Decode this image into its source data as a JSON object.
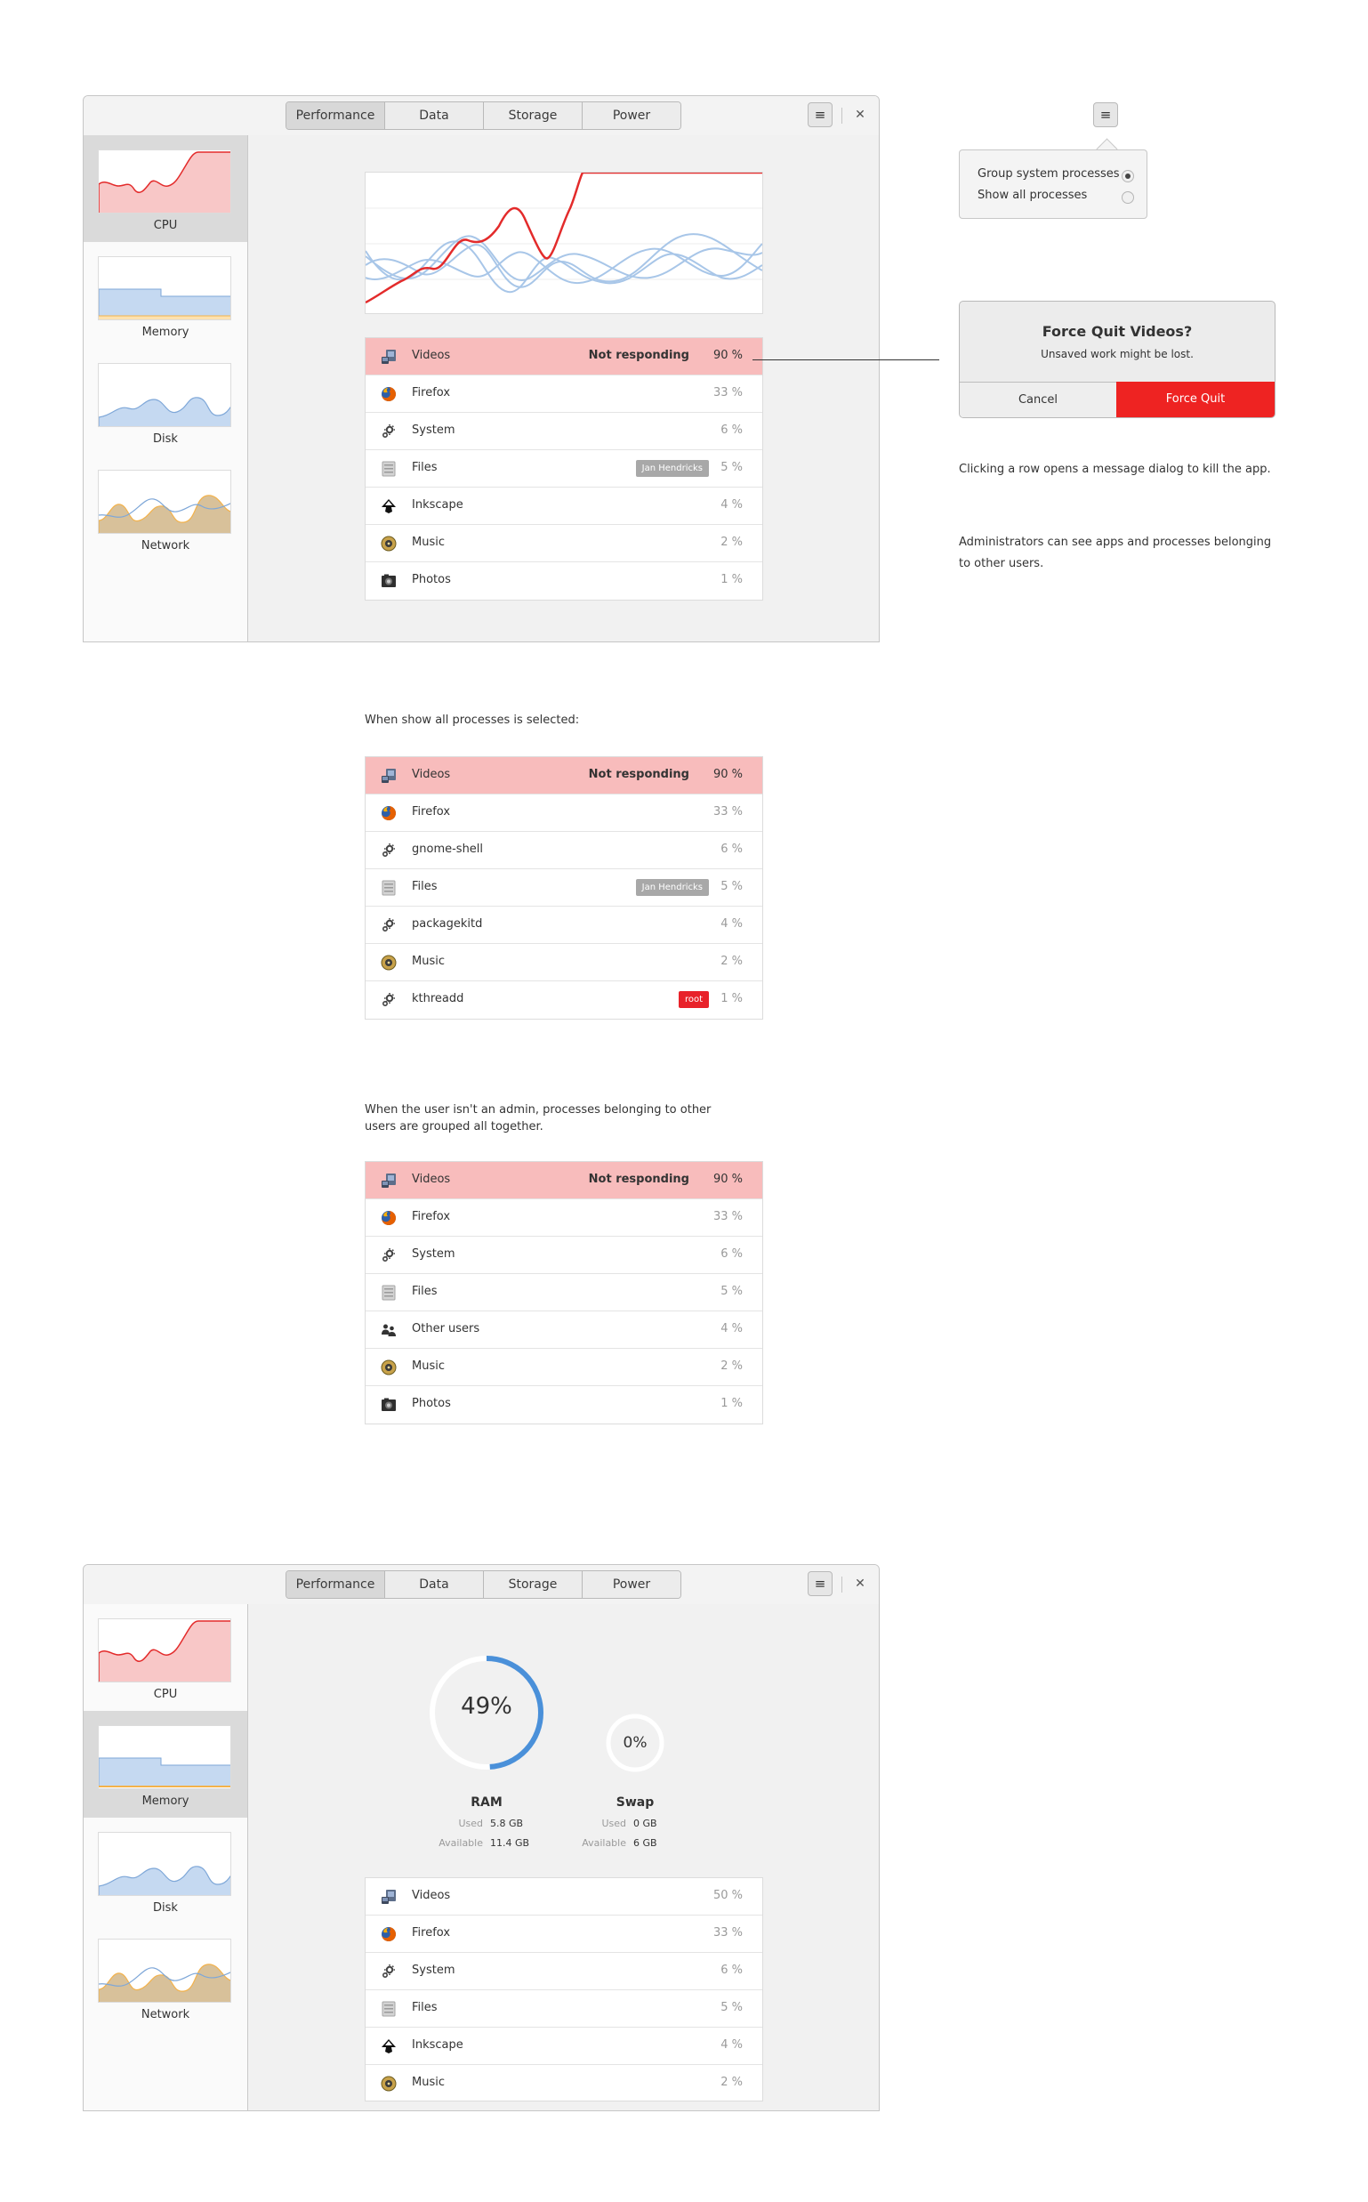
{
  "window": {
    "tabs": [
      "Performance",
      "Data",
      "Storage",
      "Power"
    ],
    "menu_icon": "hamburger-icon",
    "close_icon": "close-icon",
    "sidebar": [
      "CPU",
      "Memory",
      "Disk",
      "Network"
    ]
  },
  "list1": [
    {
      "name": "Videos",
      "status": "Not responding",
      "value": "90 %",
      "icon": "videos-icon"
    },
    {
      "name": "Firefox",
      "value": "33 %",
      "icon": "firefox-icon"
    },
    {
      "name": "System",
      "value": "6 %",
      "icon": "gear-icon"
    },
    {
      "name": "Files",
      "badge": "Jan Hendricks",
      "value": "5 %",
      "icon": "files-icon"
    },
    {
      "name": "Inkscape",
      "value": "4 %",
      "icon": "inkscape-icon"
    },
    {
      "name": "Music",
      "value": "2 %",
      "icon": "music-icon"
    },
    {
      "name": "Photos",
      "value": "1 %",
      "icon": "photos-icon"
    }
  ],
  "popover": {
    "options": [
      "Group system processes",
      "Show all processes"
    ],
    "selected": 0
  },
  "dialog": {
    "title": "Force Quit Videos?",
    "subtitle": "Unsaved work might be lost.",
    "cancel": "Cancel",
    "confirm": "Force Quit"
  },
  "notes": {
    "dialog_note": "Clicking a row opens a message dialog to kill the app.",
    "admin_note_1": "Administrators can see apps and processes belonging",
    "admin_note_2": "to other users.",
    "all_processes_note": "When show all processes is selected:",
    "non_admin_note_1": "When the user isn't an admin, processes belonging to other",
    "non_admin_note_2": "users are grouped all together."
  },
  "list2": [
    {
      "name": "Videos",
      "status": "Not responding",
      "value": "90 %",
      "icon": "videos-icon"
    },
    {
      "name": "Firefox",
      "value": "33 %",
      "icon": "firefox-icon"
    },
    {
      "name": "gnome-shell",
      "value": "6 %",
      "icon": "gear-icon"
    },
    {
      "name": "Files",
      "badge": "Jan Hendricks",
      "value": "5 %",
      "icon": "files-icon"
    },
    {
      "name": "packagekitd",
      "value": "4 %",
      "icon": "gear-icon"
    },
    {
      "name": "Music",
      "value": "2 %",
      "icon": "music-icon"
    },
    {
      "name": "kthreadd",
      "badge": "root",
      "badge_color": "#e8222a",
      "value": "1 %",
      "icon": "gear-icon"
    }
  ],
  "list3": [
    {
      "name": "Videos",
      "status": "Not responding",
      "value": "90 %",
      "icon": "videos-icon"
    },
    {
      "name": "Firefox",
      "value": "33 %",
      "icon": "firefox-icon"
    },
    {
      "name": "System",
      "value": "6 %",
      "icon": "gear-icon"
    },
    {
      "name": "Files",
      "value": "5 %",
      "icon": "files-icon"
    },
    {
      "name": "Other users",
      "value": "4 %",
      "icon": "users-icon"
    },
    {
      "name": "Music",
      "value": "2 %",
      "icon": "music-icon"
    },
    {
      "name": "Photos",
      "value": "1 %",
      "icon": "photos-icon"
    }
  ],
  "memory": {
    "ram": {
      "label": "RAM",
      "percent": "49%",
      "fraction": 0.49,
      "used_key": "Used",
      "used": "5.8 GB",
      "avail_key": "Available",
      "available": "11.4 GB"
    },
    "swap": {
      "label": "Swap",
      "percent": "0%",
      "fraction": 0,
      "used_key": "Used",
      "used": "0 GB",
      "avail_key": "Available",
      "available": "6 GB"
    }
  },
  "list4": [
    {
      "name": "Videos",
      "value": "50 %",
      "icon": "videos-icon"
    },
    {
      "name": "Firefox",
      "value": "33 %",
      "icon": "firefox-icon"
    },
    {
      "name": "System",
      "value": "6 %",
      "icon": "gear-icon"
    },
    {
      "name": "Files",
      "value": "5 %",
      "icon": "files-icon"
    },
    {
      "name": "Inkscape",
      "value": "4 %",
      "icon": "inkscape-icon"
    },
    {
      "name": "Music",
      "value": "2 %",
      "icon": "music-icon"
    }
  ],
  "colors": {
    "highlight_row": "#f8bcbc",
    "cpu_line": "#e32b2b",
    "cpu_fill": "#f8c7c7",
    "memory_fill": "#c5d9f1",
    "memory_line": "#7ea7d8",
    "swap_line": "#f3b24b",
    "network_fill": "#d8c19a",
    "accent_blue": "#4a90d9",
    "force_quit_red": "#ee2322",
    "badge_gray": "#a8a8a8"
  }
}
